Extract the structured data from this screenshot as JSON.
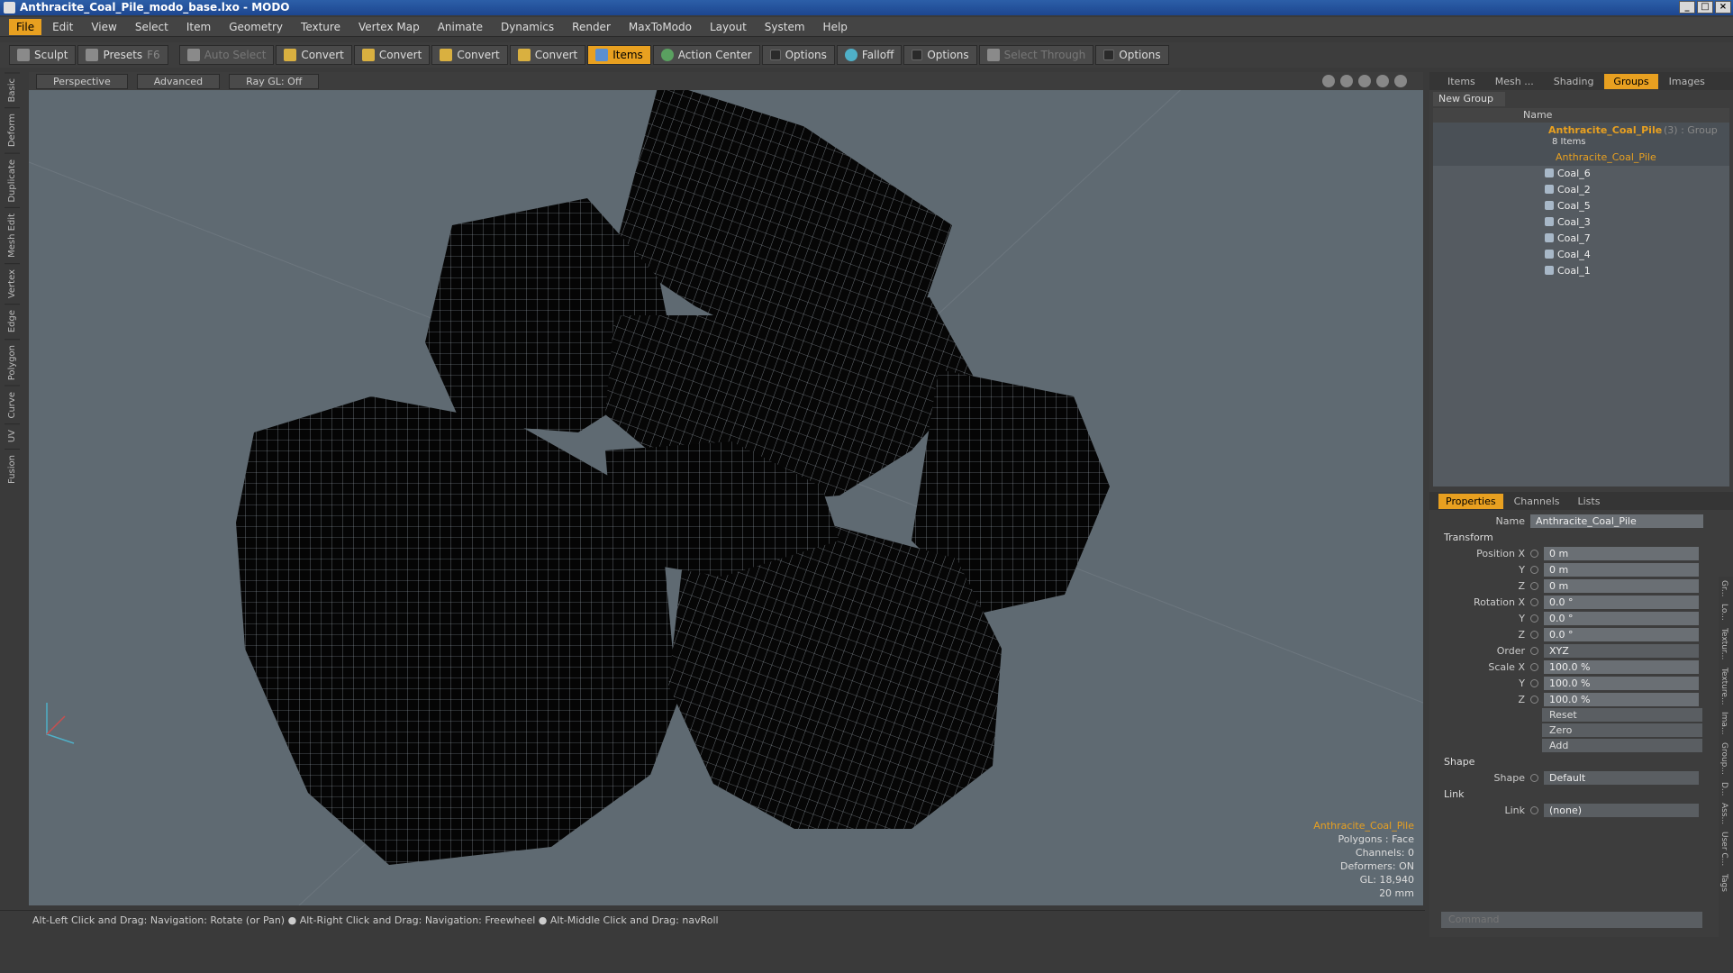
{
  "window": {
    "title": "Anthracite_Coal_Pile_modo_base.lxo - MODO"
  },
  "menu": [
    "File",
    "Edit",
    "View",
    "Select",
    "Item",
    "Geometry",
    "Texture",
    "Vertex Map",
    "Animate",
    "Dynamics",
    "Render",
    "MaxToModo",
    "Layout",
    "System",
    "Help"
  ],
  "toolbar": {
    "sculpt": "Sculpt",
    "presets": "Presets",
    "presets_key": "F6",
    "auto_select": "Auto Select",
    "convert1": "Convert",
    "convert2": "Convert",
    "convert3": "Convert",
    "convert4": "Convert",
    "items": "Items",
    "action_center": "Action Center",
    "options1": "Options",
    "falloff": "Falloff",
    "options2": "Options",
    "select_through": "Select Through",
    "options3": "Options"
  },
  "left_tabs": [
    "Basic",
    "Deform",
    "Duplicate",
    "Mesh Edit",
    "Vertex",
    "Edge",
    "Polygon",
    "Curve",
    "UV",
    "Fusion"
  ],
  "viewport": {
    "view": "Perspective",
    "mode": "Advanced",
    "raygl": "Ray GL: Off",
    "info": {
      "selected": "Anthracite_Coal_Pile",
      "polygons": "Polygons : Face",
      "channels": "Channels: 0",
      "deformers": "Deformers: ON",
      "gl": "GL: 18,940",
      "scale": "20 mm"
    }
  },
  "status": "Alt-Left Click and Drag: Navigation: Rotate (or Pan) ●  Alt-Right Click and Drag: Navigation: Freewheel ●  Alt-Middle Click and Drag: navRoll",
  "right_tabs": [
    "Items",
    "Mesh ...",
    "Shading",
    "Groups",
    "Images"
  ],
  "groups": {
    "new_group": "New Group",
    "name_col": "Name",
    "group_name": "Anthracite_Coal_Pile",
    "group_suffix": "(3) : Group",
    "item_count": "8 Items",
    "children": [
      "Anthracite_Coal_Pile",
      "Coal_6",
      "Coal_2",
      "Coal_5",
      "Coal_3",
      "Coal_7",
      "Coal_4",
      "Coal_1"
    ]
  },
  "prop_tabs": [
    "Properties",
    "Channels",
    "Lists"
  ],
  "properties": {
    "name_label": "Name",
    "name_value": "Anthracite_Coal_Pile",
    "transform": "Transform",
    "position_label": "Position X",
    "pos_x": "0 m",
    "pos_y": "0 m",
    "pos_z": "0 m",
    "rotation_label": "Rotation X",
    "rot_x": "0.0 °",
    "rot_y": "0.0 °",
    "rot_z": "0.0 °",
    "order_label": "Order",
    "order": "XYZ",
    "scale_label": "Scale X",
    "scl_x": "100.0 %",
    "scl_y": "100.0 %",
    "scl_z": "100.0 %",
    "y": "Y",
    "z": "Z",
    "reset": "Reset",
    "zero": "Zero",
    "add": "Add",
    "shape_section": "Shape",
    "shape_label": "Shape",
    "shape": "Default",
    "link_section": "Link",
    "link_label": "Link",
    "link": "(none)"
  },
  "right_vtabs": [
    "Gr...",
    "Lo...",
    "Textur...",
    "Texture...",
    "Ima...",
    "Group...",
    "D...",
    "Ass...",
    "User C...",
    "Tags"
  ],
  "command_placeholder": "Command"
}
